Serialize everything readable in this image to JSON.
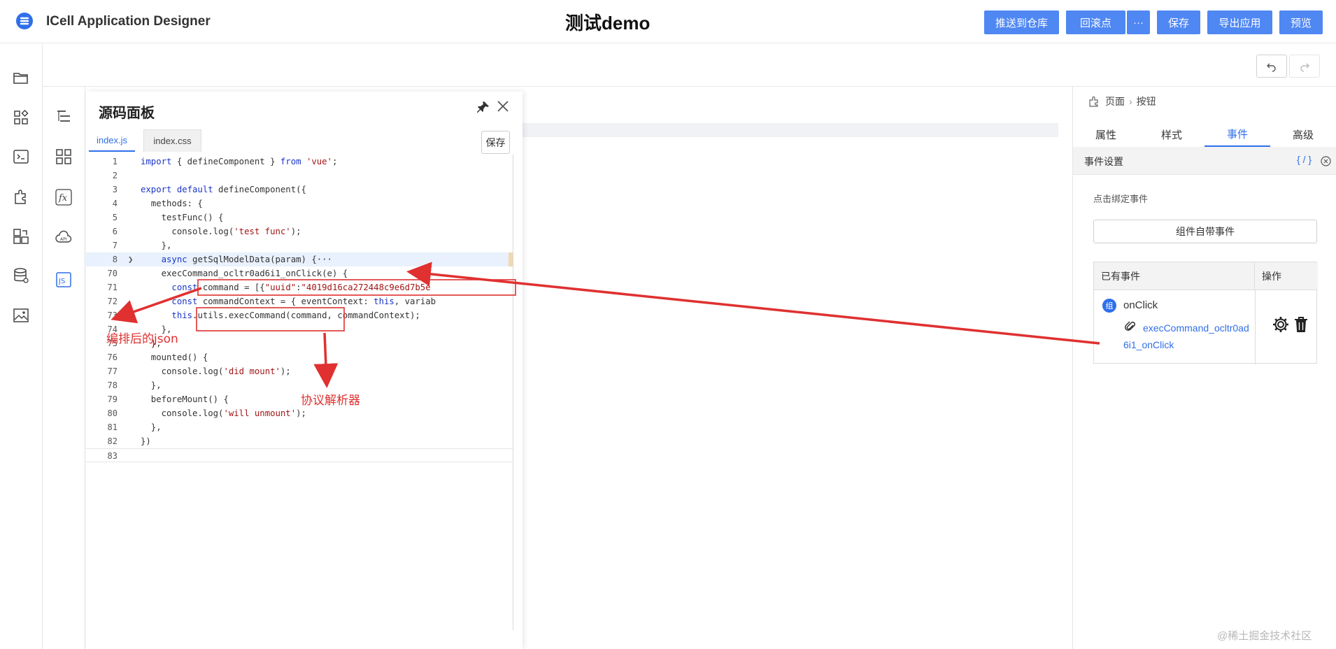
{
  "header": {
    "app_name": "ICell Application Designer",
    "page_title": "测试demo",
    "buttons": {
      "push": "推送到仓库",
      "rollback": "回滚点",
      "more": "···",
      "save": "保存",
      "export": "导出应用",
      "preview": "预览"
    },
    "accent_color": "#4f87f3"
  },
  "rail_primary": [
    "folder-icon",
    "components-icon",
    "terminal-icon",
    "plugin-icon",
    "puzzle-icon",
    "database-icon",
    "image-icon"
  ],
  "rail_secondary": [
    "outline-icon",
    "grid-icon",
    "function-icon",
    "api-cloud-icon",
    "js-icon"
  ],
  "code_panel": {
    "title": "源码面板",
    "tabs": [
      "index.js",
      "index.css"
    ],
    "active_tab": "index.js",
    "save_label": "保存",
    "lines": [
      {
        "n": "1",
        "code": "import { defineComponent } from 'vue';"
      },
      {
        "n": "2",
        "code": ""
      },
      {
        "n": "3",
        "code": "export default defineComponent({"
      },
      {
        "n": "4",
        "code": "  methods: {"
      },
      {
        "n": "5",
        "code": "    testFunc() {"
      },
      {
        "n": "6",
        "code": "      console.log('test func');"
      },
      {
        "n": "7",
        "code": "    },"
      },
      {
        "n": "8",
        "code": "    async getSqlModelData(param) {···"
      },
      {
        "n": "70",
        "code": "    execCommand_ocltr0ad6i1_onClick(e) {"
      },
      {
        "n": "71",
        "code": "      const command = [{\"uuid\":\"4019d16ca272448c9e6d7b5e"
      },
      {
        "n": "72",
        "code": "      const commandContext = { eventContext: this, variab"
      },
      {
        "n": "73",
        "code": "      this.utils.execCommand(command, commandContext);"
      },
      {
        "n": "74",
        "code": "    },"
      },
      {
        "n": "75",
        "code": "  },"
      },
      {
        "n": "76",
        "code": "  mounted() {"
      },
      {
        "n": "77",
        "code": "    console.log('did mount');"
      },
      {
        "n": "78",
        "code": "  },"
      },
      {
        "n": "79",
        "code": "  beforeMount() {"
      },
      {
        "n": "80",
        "code": "    console.log('will unmount');"
      },
      {
        "n": "81",
        "code": "  },"
      },
      {
        "n": "82",
        "code": "})"
      },
      {
        "n": "83",
        "code": ""
      }
    ]
  },
  "annotations": {
    "json_label": "编排后的json",
    "parser_label": "协议解析器",
    "color": "#e03030"
  },
  "right_panel": {
    "breadcrumb": [
      "页面",
      "按钮"
    ],
    "tabs": [
      "属性",
      "样式",
      "事件",
      "高级"
    ],
    "active_tab": "事件",
    "section_title": "事件设置",
    "section_tools": "{ / }",
    "bind_label": "点击绑定事件",
    "builtin_button": "组件自带事件",
    "table_headers": [
      "已有事件",
      "操作"
    ],
    "event": {
      "badge": "组",
      "name": "onClick",
      "handler": "execCommand_ocltr0ad6i1_onClick"
    }
  },
  "watermark": "@稀土掘金技术社区"
}
